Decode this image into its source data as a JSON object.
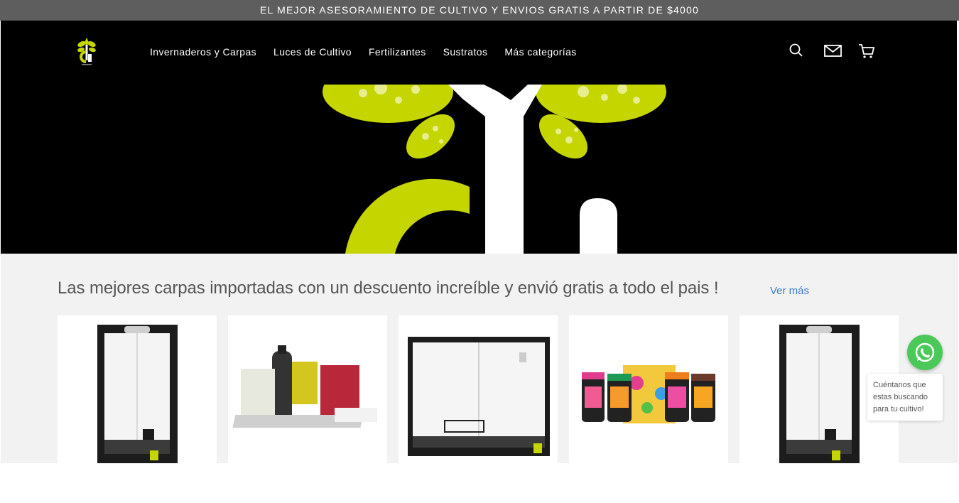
{
  "announcement": "EL MEJOR ASESORAMIENTO DE CULTIVO Y ENVIOS GRATIS A PARTIR DE $4000",
  "header": {
    "nav": [
      {
        "label": "Invernaderos y Carpas"
      },
      {
        "label": "Luces de Cultivo"
      },
      {
        "label": "Fertilizantes"
      },
      {
        "label": "Sustratos"
      },
      {
        "label": "Más categorías"
      }
    ],
    "icons": [
      "search-icon",
      "mail-icon",
      "cart-icon"
    ]
  },
  "colors": {
    "brand_green": "#c5d500",
    "announcement_bg": "#5e5e5e",
    "link_blue": "#3d7bd9",
    "whatsapp_green": "#4ac959"
  },
  "section": {
    "title": "Las mejores carpas importadas con un descuento increíble y envió gratis a todo el pais !",
    "link": "Ver más"
  },
  "products": [
    "grow-tent-tall",
    "nutrient-pack",
    "grow-tent-wide",
    "pc-fertilizer-set",
    "grow-tent-tall"
  ],
  "whatsapp": {
    "line1": "Cuéntanos que",
    "line2": "estas buscando",
    "line3": "para tu cultivo!"
  }
}
